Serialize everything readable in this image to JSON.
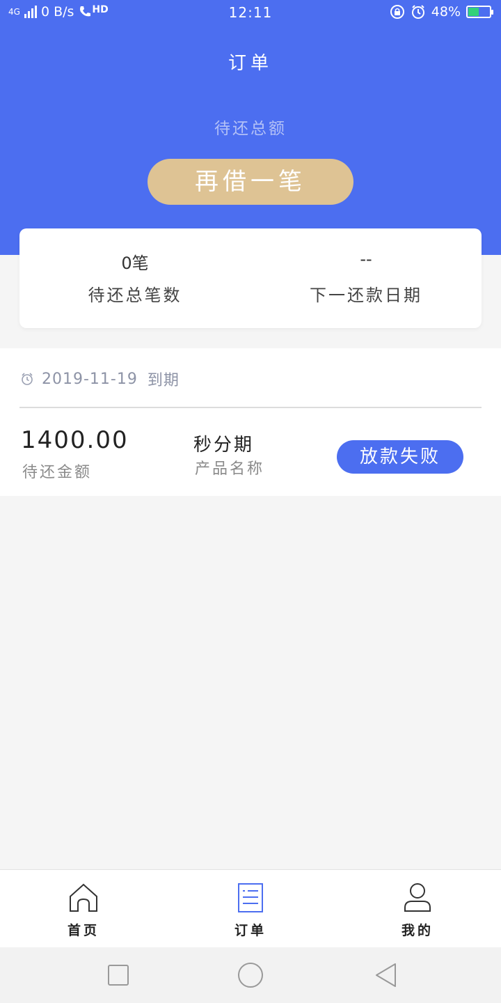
{
  "status_bar": {
    "network": "4G",
    "speed": "0 B/s",
    "call": "HD",
    "time": "12:11",
    "battery": "48%",
    "battery_level": 0.48
  },
  "header": {
    "title": "订单",
    "subtitle": "待还总额",
    "borrow_again_label": "再借一笔"
  },
  "summary": {
    "total_count_value": "0笔",
    "total_count_label": "待还总笔数",
    "next_date_value": "--",
    "next_date_label": "下一还款日期"
  },
  "order": {
    "due_date": "2019-11-19",
    "due_suffix": "到期",
    "amount_value": "1400.00",
    "amount_label": "待还金额",
    "product_value": "秒分期",
    "product_label": "产品名称",
    "status_label": "放款失败"
  },
  "tabs": [
    {
      "label": "首页",
      "icon": "home-icon"
    },
    {
      "label": "订单",
      "icon": "orders-icon"
    },
    {
      "label": "我的",
      "icon": "user-icon"
    }
  ],
  "colors": {
    "primary": "#4c6ef0",
    "gold": "#dec394",
    "background": "#f5f5f5"
  }
}
